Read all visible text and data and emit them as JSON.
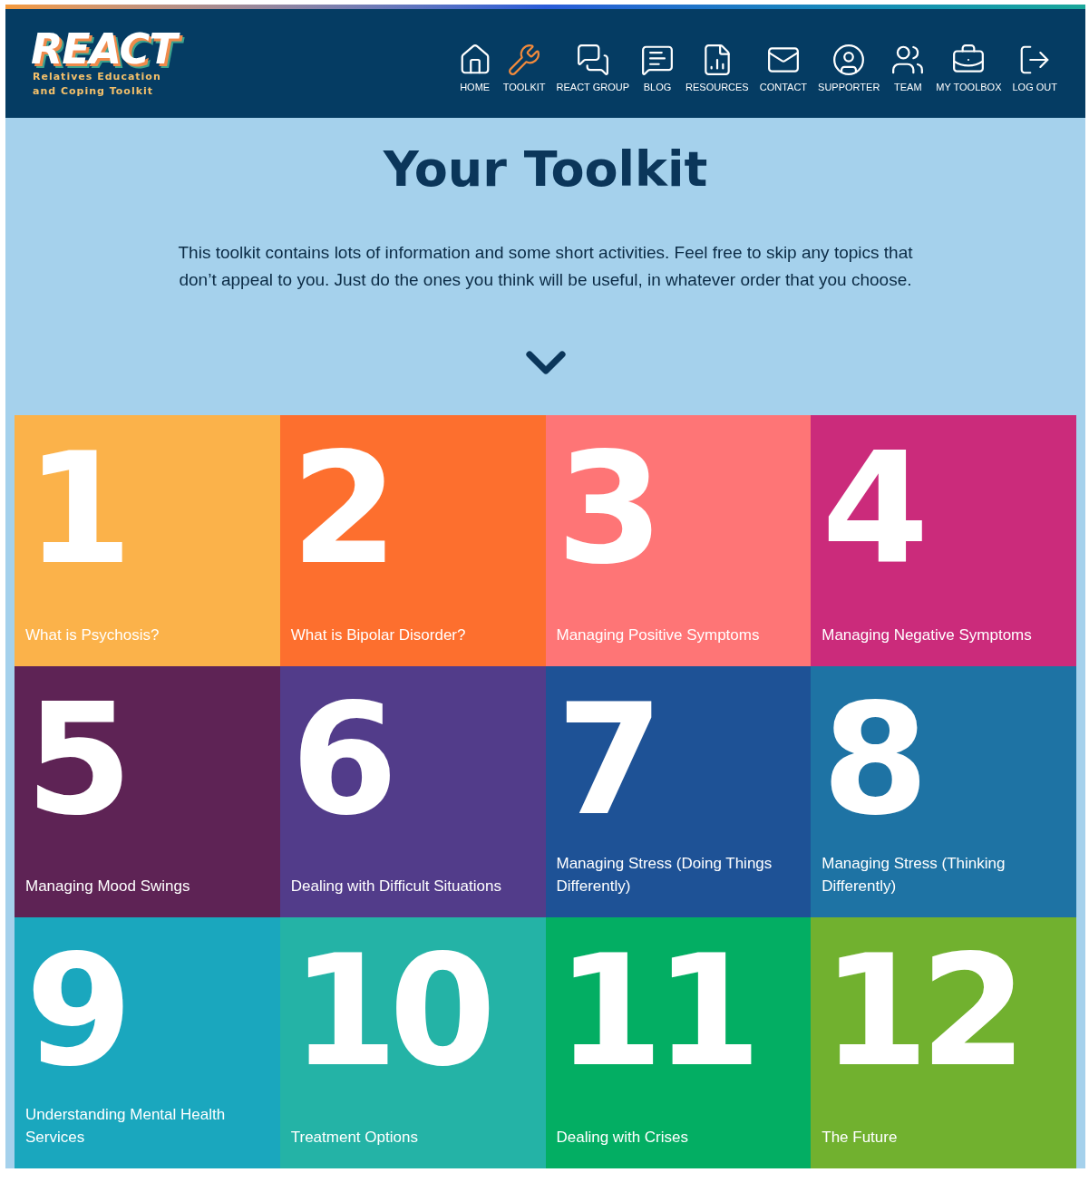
{
  "logo": {
    "name": "REACT",
    "tagline_lines": [
      "Relatives Education",
      "and Coping Toolkit"
    ]
  },
  "nav": [
    {
      "label": "HOME",
      "selected": false
    },
    {
      "label": "TOOLKIT",
      "selected": true
    },
    {
      "label": "REACT GROUP",
      "selected": false
    },
    {
      "label": "BLOG",
      "selected": false
    },
    {
      "label": "RESOURCES",
      "selected": false
    },
    {
      "label": "CONTACT",
      "selected": false
    },
    {
      "label": "SUPPORTER",
      "selected": false
    },
    {
      "label": "TEAM",
      "selected": false
    },
    {
      "label": "MY TOOLBOX",
      "selected": false
    },
    {
      "label": "LOG OUT",
      "selected": false
    }
  ],
  "heading": "Your Toolkit",
  "intro": "This toolkit contains lots of information and some short activities. Feel free to skip any topics that don’t appeal to you. Just do the ones you think will be useful, in whatever order that you choose.",
  "topics": [
    {
      "number": "1",
      "title": "What is Psychosis?",
      "color": "#fbb24a"
    },
    {
      "number": "2",
      "title": "What is Bipolar Disorder?",
      "color": "#fd6f2e"
    },
    {
      "number": "3",
      "title": "Managing Positive Symptoms",
      "color": "#fe7576"
    },
    {
      "number": "4",
      "title": "Managing Negative Symptoms",
      "color": "#cb2b7b"
    },
    {
      "number": "5",
      "title": "Managing Mood Swings",
      "color": "#5e2355"
    },
    {
      "number": "6",
      "title": "Dealing with Difficult Situations",
      "color": "#523c8a"
    },
    {
      "number": "7",
      "title": "Managing Stress (Doing Things Differently)",
      "color": "#1e5296"
    },
    {
      "number": "8",
      "title": "Managing Stress (Thinking Differently)",
      "color": "#1e73a4"
    },
    {
      "number": "9",
      "title": "Understanding Mental Health Services",
      "color": "#1aa7be"
    },
    {
      "number": "10",
      "title": "Treatment Options",
      "color": "#24b3a6"
    },
    {
      "number": "11",
      "title": "Dealing with Crises",
      "color": "#03ae63"
    },
    {
      "number": "12",
      "title": "The Future",
      "color": "#71b12f"
    }
  ]
}
